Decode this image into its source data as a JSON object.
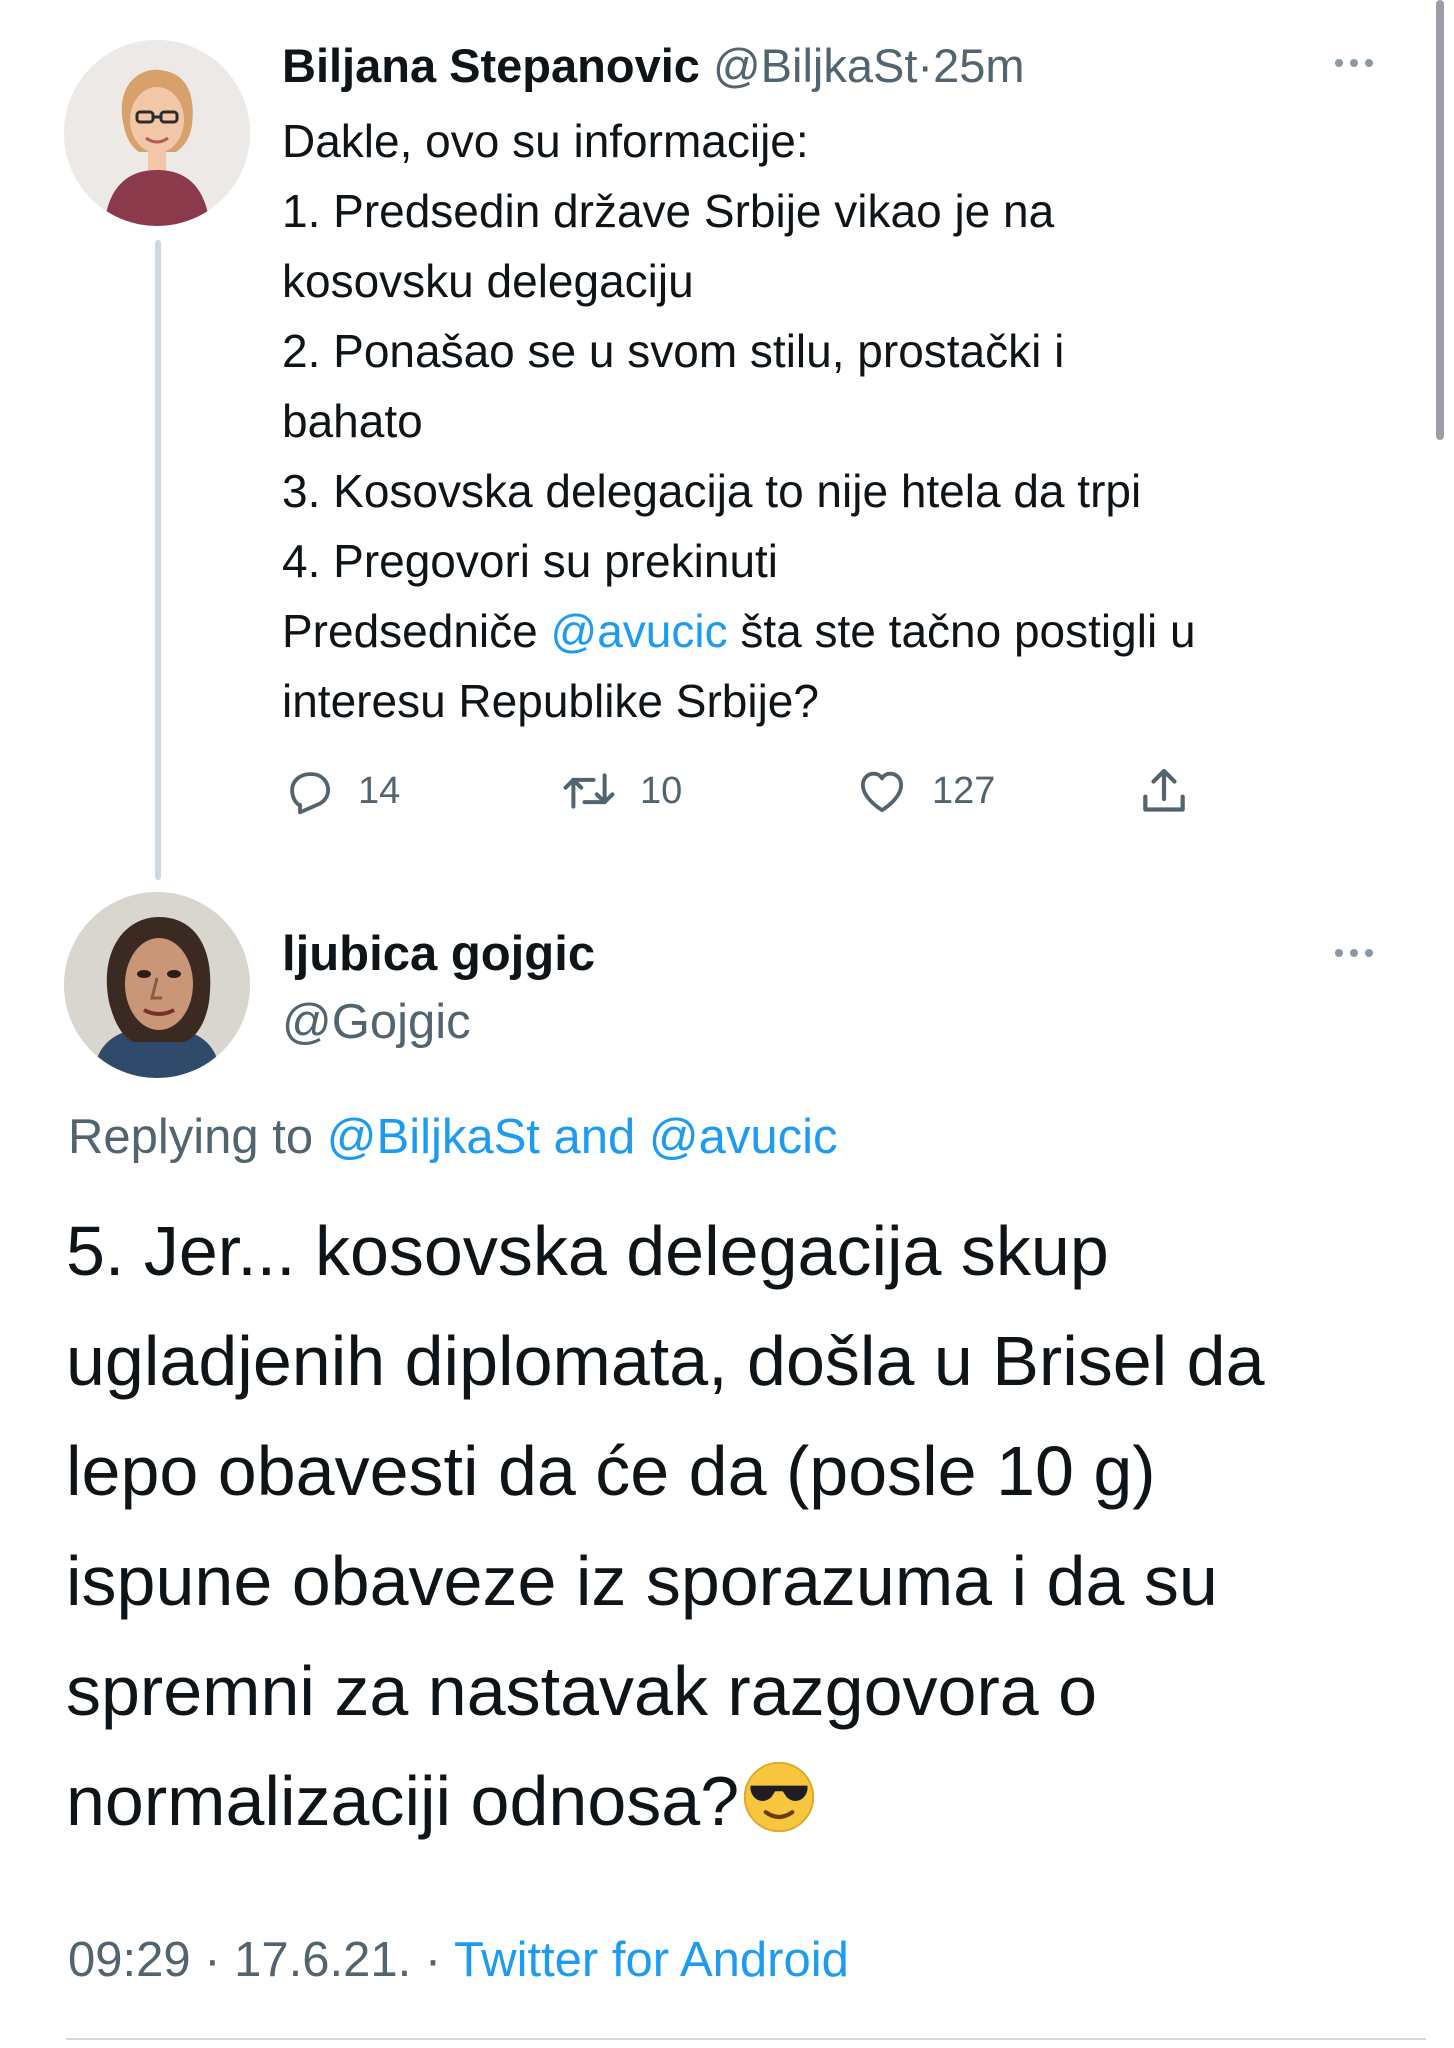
{
  "parent_tweet": {
    "name": "Biljana Stepanovic",
    "handle": "@BiljkaSt",
    "separator": "·",
    "time": "25m",
    "avatar_icon": "person-photo-avatar",
    "more_icon": "more-horizontal-icon",
    "body_lines": {
      "l1": "Dakle, ovo su informacije:",
      "l2": "1. Predsedin države Srbije vikao je na",
      "l3": "kosovsku delegaciju",
      "l4": "2. Ponašao se u svom stilu, prostački i",
      "l5": "bahato",
      "l6": "3. Kosovska delegacija to nije htela da trpi",
      "l7": "4. Pregovori su prekinuti",
      "l8_pre": "Predsedniče ",
      "l8_mention": "@avucic",
      "l8_post": " šta ste tačno postigli u",
      "l9": "interesu Republike Srbije?"
    },
    "actions": {
      "reply_count": "14",
      "retweet_count": "10",
      "like_count": "127"
    }
  },
  "reply_tweet": {
    "name": "ljubica gojgic",
    "handle": "@Gojgic",
    "avatar_icon": "caricature-avatar",
    "more_icon": "more-horizontal-icon",
    "replying_prefix": "Replying to ",
    "replying_user1": "@BiljkaSt",
    "replying_and": " and ",
    "replying_user2": "@avucic",
    "body_lines": {
      "l1": "5. Jer... kosovska delegacija skup",
      "l2": "ugladjenih diplomata, došla u Brisel da",
      "l3": "lepo obavesti da će da (posle 10 g)",
      "l4": "ispune obaveze iz sporazuma i da su",
      "l5": "spremni za nastavak razgovora o",
      "l6": "normalizaciji odnosa?"
    },
    "emoji_icon": "sunglasses-emoji",
    "meta": {
      "time": "09:29",
      "sep1": " · ",
      "date": "17.6.21.",
      "sep2": " · ",
      "source": "Twitter for Android"
    }
  },
  "colors": {
    "text": "#0f1419",
    "secondary": "#536471",
    "link": "#1d9bf0",
    "thread_line": "#cfd9de"
  }
}
